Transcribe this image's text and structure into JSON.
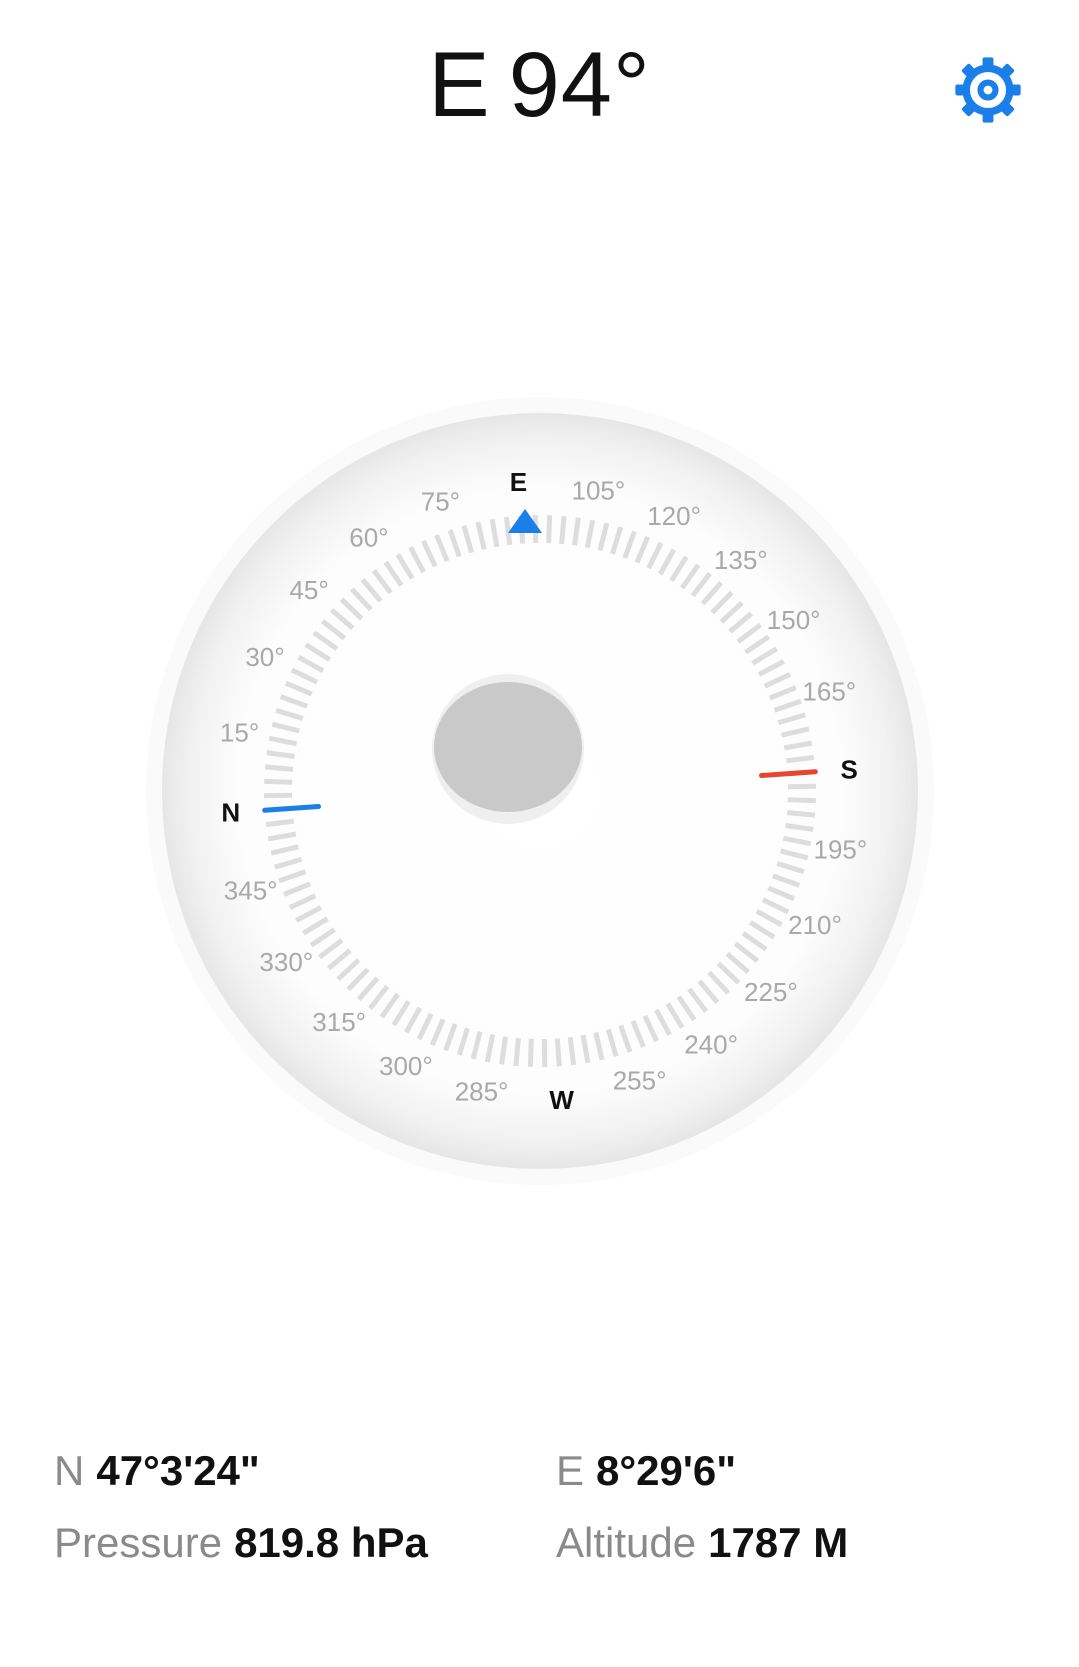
{
  "header": {
    "direction": "E",
    "bearing": "94°",
    "settings_icon": "gear-icon",
    "accent_color": "#1a7fe8"
  },
  "compass": {
    "heading_degrees": 94,
    "cardinals": {
      "north": "N",
      "east": "E",
      "south": "S",
      "west": "W"
    },
    "degree_labels": [
      "15°",
      "30°",
      "45°",
      "60°",
      "75°",
      "105°",
      "120°",
      "135°",
      "150°",
      "165°",
      "195°",
      "210°",
      "225°",
      "240°",
      "255°",
      "285°",
      "300°",
      "315°",
      "330°",
      "345°"
    ],
    "north_needle_color": "#1a7fe8",
    "south_needle_color": "#e64530",
    "pointer_color": "#1a7fe8"
  },
  "location": {
    "latitude_label": "N",
    "latitude_value": "47°3'24\"",
    "longitude_label": "E",
    "longitude_value": "8°29'6\"",
    "pressure_label": "Pressure",
    "pressure_value": "819.8 hPa",
    "altitude_label": "Altitude",
    "altitude_value": "1787 M"
  }
}
